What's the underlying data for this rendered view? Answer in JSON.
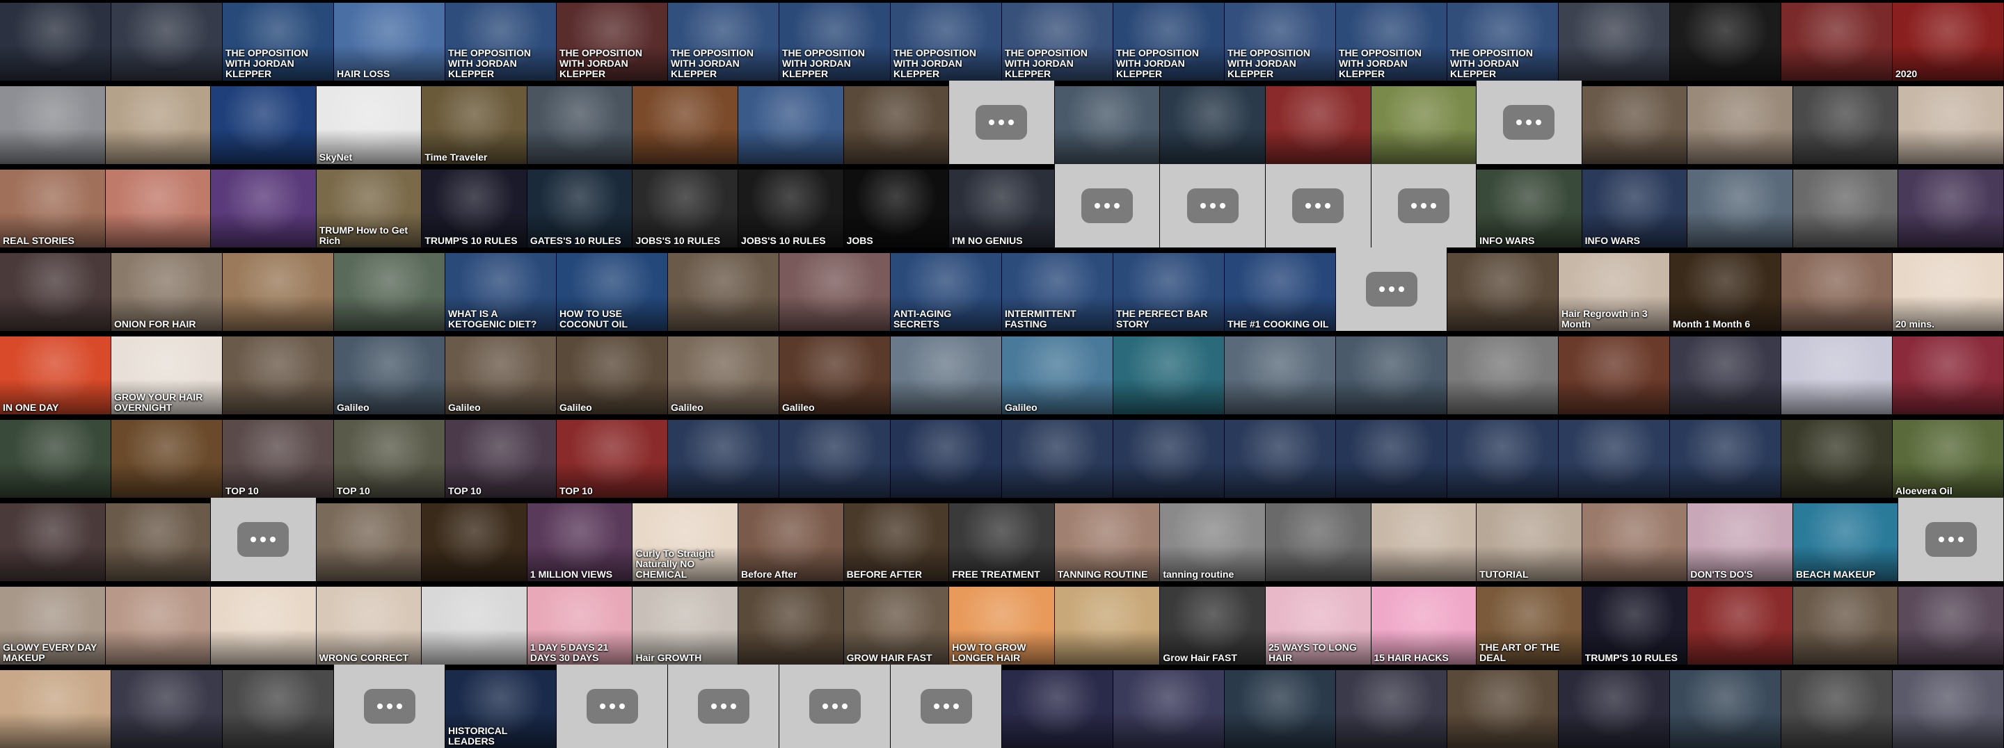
{
  "colors": {
    "background": "#000000",
    "placeholder": "#c9c9c9",
    "more_button": "#7b7b7b"
  },
  "more_icon": "ellipsis-icon",
  "rows": [
    {
      "tiles": [
        {
          "caption": "",
          "color": "#2b3140"
        },
        {
          "caption": "",
          "color": "#353b4a"
        },
        {
          "caption": "THE OPPOSITION WITH JORDAN KLEPPER",
          "color": "#274a7a"
        },
        {
          "caption": "HAIR LOSS",
          "color": "#4a6fa5"
        },
        {
          "caption": "THE OPPOSITION WITH JORDAN KLEPPER",
          "color": "#2e4d7c"
        },
        {
          "caption": "THE OPPOSITION WITH JORDAN KLEPPER",
          "color": "#5a2d2d"
        },
        {
          "caption": "THE OPPOSITION WITH JORDAN KLEPPER",
          "color": "#32507e"
        },
        {
          "caption": "THE OPPOSITION WITH JORDAN KLEPPER",
          "color": "#2c4a78"
        },
        {
          "caption": "THE OPPOSITION WITH JORDAN KLEPPER",
          "color": "#304d7a"
        },
        {
          "caption": "THE OPPOSITION WITH JORDAN KLEPPER",
          "color": "#38517a"
        },
        {
          "caption": "THE OPPOSITION WITH JORDAN KLEPPER",
          "color": "#2a4876"
        },
        {
          "caption": "THE OPPOSITION WITH JORDAN KLEPPER",
          "color": "#334f7d"
        },
        {
          "caption": "THE OPPOSITION WITH JORDAN KLEPPER",
          "color": "#2d4b79"
        },
        {
          "caption": "THE OPPOSITION WITH JORDAN KLEPPER",
          "color": "#314e7b"
        },
        {
          "caption": "",
          "color": "#3c4250"
        },
        {
          "caption": "",
          "color": "#1b1b1b"
        },
        {
          "caption": "",
          "color": "#7a2a2a"
        },
        {
          "caption": "2020",
          "color": "#8a1f1f"
        }
      ]
    },
    {
      "tiles": [
        {
          "caption": "",
          "color": "#8d8f94"
        },
        {
          "caption": "",
          "color": "#b5a28a"
        },
        {
          "caption": "",
          "color": "#1e3f7a"
        },
        {
          "caption": "SkyNet",
          "color": "#e8e8e8"
        },
        {
          "caption": "Time Traveler",
          "color": "#6a5a3a"
        },
        {
          "caption": "",
          "color": "#4a5560"
        },
        {
          "caption": "",
          "color": "#7a4a2a"
        },
        {
          "caption": "",
          "color": "#3a5a8a"
        },
        {
          "caption": "",
          "color": "#5a4a3a"
        },
        {
          "caption": "",
          "color": "placeholder"
        },
        {
          "caption": "",
          "color": "#4a5a6a"
        },
        {
          "caption": "",
          "color": "#2a3a4a"
        },
        {
          "caption": "",
          "color": "#8a2a2a"
        },
        {
          "caption": "",
          "color": "#7a8a4a"
        },
        {
          "caption": "",
          "color": "placeholder"
        },
        {
          "caption": "",
          "color": "#6a5a4a"
        },
        {
          "caption": "",
          "color": "#9a8a7a"
        },
        {
          "caption": "",
          "color": "#4a4a4a"
        },
        {
          "caption": "",
          "color": "#c8b8a8"
        }
      ]
    },
    {
      "tiles": [
        {
          "caption": "REAL STORIES",
          "color": "#a0705a"
        },
        {
          "caption": "",
          "color": "#c07a6a"
        },
        {
          "caption": "",
          "color": "#5a3a7a"
        },
        {
          "caption": "TRUMP How to Get Rich",
          "color": "#7a6a4a"
        },
        {
          "caption": "TRUMP'S 10 RULES",
          "color": "#1a1a2a"
        },
        {
          "caption": "GATES'S 10 RULES",
          "color": "#1a2a3a"
        },
        {
          "caption": "JOBS'S 10 RULES",
          "color": "#2a2a2a"
        },
        {
          "caption": "JOBS'S 10 RULES",
          "color": "#1a1a1a"
        },
        {
          "caption": "JOBS",
          "color": "#0e0e0e"
        },
        {
          "caption": "I'M NO GENIUS",
          "color": "#2a2f3a"
        },
        {
          "caption": "",
          "color": "placeholder"
        },
        {
          "caption": "",
          "color": "placeholder"
        },
        {
          "caption": "",
          "color": "placeholder"
        },
        {
          "caption": "",
          "color": "placeholder"
        },
        {
          "caption": "INFO WARS",
          "color": "#3a4a3a"
        },
        {
          "caption": "INFO WARS",
          "color": "#2a3a5a"
        },
        {
          "caption": "",
          "color": "#5a6a7a"
        },
        {
          "caption": "",
          "color": "#6a6a6a"
        },
        {
          "caption": "",
          "color": "#4a3a5a"
        }
      ]
    },
    {
      "tiles": [
        {
          "caption": "",
          "color": "#4a3a3a"
        },
        {
          "caption": "ONION FOR HAIR",
          "color": "#8a7a6a"
        },
        {
          "caption": "",
          "color": "#9a7a5a"
        },
        {
          "caption": "",
          "color": "#5a6a5a"
        },
        {
          "caption": "WHAT IS A KETOGENIC DIET?",
          "color": "#2a4a7a"
        },
        {
          "caption": "HOW TO USE COCONUT OIL",
          "color": "#24487a"
        },
        {
          "caption": "",
          "color": "#6a5a4a"
        },
        {
          "caption": "",
          "color": "#7a5a5a"
        },
        {
          "caption": "ANTI-AGING SECRETS",
          "color": "#2a4a7a"
        },
        {
          "caption": "INTERMITTENT FASTING",
          "color": "#2c4c7c"
        },
        {
          "caption": "THE PERFECT BAR STORY",
          "color": "#2a4a7a"
        },
        {
          "caption": "THE #1 COOKING OIL",
          "color": "#27477a"
        },
        {
          "caption": "",
          "color": "placeholder"
        },
        {
          "caption": "",
          "color": "#5a4a3a"
        },
        {
          "caption": "Hair Regrowth in 3 Month",
          "color": "#c8b8a8"
        },
        {
          "caption": "Month 1 Month 6",
          "color": "#3a2a1a"
        },
        {
          "caption": "",
          "color": "#8a6a5a"
        },
        {
          "caption": "20 mins.",
          "color": "#e8d8c8"
        }
      ]
    },
    {
      "tiles": [
        {
          "caption": "IN ONE DAY",
          "color": "#d84a2a"
        },
        {
          "caption": "GROW YOUR HAIR OVERNIGHT",
          "color": "#e8e0d8"
        },
        {
          "caption": "",
          "color": "#6a5a4a"
        },
        {
          "caption": "Galileo",
          "color": "#4a5a6a"
        },
        {
          "caption": "Galileo",
          "color": "#6a5a4a"
        },
        {
          "caption": "Galileo",
          "color": "#5a4a3a"
        },
        {
          "caption": "Galileo",
          "color": "#7a6a5a"
        },
        {
          "caption": "Galileo",
          "color": "#5a3a2a"
        },
        {
          "caption": "",
          "color": "#6a7a8a"
        },
        {
          "caption": "Galileo",
          "color": "#4a7a9a"
        },
        {
          "caption": "",
          "color": "#2a6a7a"
        },
        {
          "caption": "",
          "color": "#5a6a7a"
        },
        {
          "caption": "",
          "color": "#4a5a6a"
        },
        {
          "caption": "",
          "color": "#7a7a7a"
        },
        {
          "caption": "",
          "color": "#6a3a2a"
        },
        {
          "caption": "",
          "color": "#3a3a4a"
        },
        {
          "caption": "",
          "color": "#c8c8d8"
        },
        {
          "caption": "",
          "color": "#8a2a3a"
        }
      ]
    },
    {
      "tiles": [
        {
          "caption": "",
          "color": "#3a4a3a"
        },
        {
          "caption": "",
          "color": "#6a4a2a"
        },
        {
          "caption": "TOP 10",
          "color": "#5a4a4a"
        },
        {
          "caption": "TOP 10",
          "color": "#5a5a4a"
        },
        {
          "caption": "TOP 10",
          "color": "#4a3a4a"
        },
        {
          "caption": "TOP 10",
          "color": "#8a2a2a"
        },
        {
          "caption": "",
          "color": "#2a3a5a"
        },
        {
          "caption": "",
          "color": "#2a3a5a"
        },
        {
          "caption": "",
          "color": "#243456"
        },
        {
          "caption": "",
          "color": "#2a3a5a"
        },
        {
          "caption": "",
          "color": "#283858"
        },
        {
          "caption": "",
          "color": "#2a3a5a"
        },
        {
          "caption": "",
          "color": "#263656"
        },
        {
          "caption": "",
          "color": "#2a3a5a"
        },
        {
          "caption": "",
          "color": "#2c3c5c"
        },
        {
          "caption": "",
          "color": "#2a3a5a"
        },
        {
          "caption": "",
          "color": "#3a3a2a"
        },
        {
          "caption": "Aloevera Oil",
          "color": "#5a6a3a"
        }
      ]
    },
    {
      "tiles": [
        {
          "caption": "",
          "color": "#4a3a3a"
        },
        {
          "caption": "",
          "color": "#6a5a4a"
        },
        {
          "caption": "",
          "color": "placeholder"
        },
        {
          "caption": "",
          "color": "#7a6a5a"
        },
        {
          "caption": "",
          "color": "#3a2a1a"
        },
        {
          "caption": "1 MILLION VIEWS",
          "color": "#5a3a5a"
        },
        {
          "caption": "Curly To Straight Naturally NO CHEMICAL",
          "color": "#e8d8c8"
        },
        {
          "caption": "Before After",
          "color": "#7a5a4a"
        },
        {
          "caption": "BEFORE AFTER",
          "color": "#4a3a2a"
        },
        {
          "caption": "FREE TREATMENT",
          "color": "#3a3a3a"
        },
        {
          "caption": "TANNING ROUTINE",
          "color": "#a08070"
        },
        {
          "caption": "tanning routine",
          "color": "#8a8a8a"
        },
        {
          "caption": "",
          "color": "#6a6a6a"
        },
        {
          "caption": "",
          "color": "#c8b8a8"
        },
        {
          "caption": "TUTORIAL",
          "color": "#b8a898"
        },
        {
          "caption": "",
          "color": "#9a7a6a"
        },
        {
          "caption": "DON'TS DO'S",
          "color": "#c8a8b8"
        },
        {
          "caption": "BEACH MAKEUP",
          "color": "#2a7a9a"
        },
        {
          "caption": "",
          "color": "placeholder"
        }
      ]
    },
    {
      "tiles": [
        {
          "caption": "GLOWY EVERY DAY MAKEUP",
          "color": "#a8988a"
        },
        {
          "caption": "",
          "color": "#b89888"
        },
        {
          "caption": "",
          "color": "#e8d8c8"
        },
        {
          "caption": "WRONG CORRECT",
          "color": "#d8c8b8"
        },
        {
          "caption": "",
          "color": "#d8d8d8"
        },
        {
          "caption": "1 DAY 5 DAYS 21 DAYS 30 DAYS",
          "color": "#e8a8b8"
        },
        {
          "caption": "Hair GROWTH",
          "color": "#c8c0b8"
        },
        {
          "caption": "",
          "color": "#5a4a3a"
        },
        {
          "caption": "GROW HAIR FAST",
          "color": "#6a5a4a"
        },
        {
          "caption": "HOW TO GROW LONGER HAIR",
          "color": "#e89a5a"
        },
        {
          "caption": "",
          "color": "#c8a878"
        },
        {
          "caption": "Grow Hair FAST",
          "color": "#3a3a3a"
        },
        {
          "caption": "25 WAYS TO LONG HAIR",
          "color": "#e8b8c8"
        },
        {
          "caption": "15 HAIR HACKS",
          "color": "#f0a8c8"
        },
        {
          "caption": "THE ART OF THE DEAL",
          "color": "#7a5a3a"
        },
        {
          "caption": "TRUMP'S 10 RULES",
          "color": "#1a1a2a"
        },
        {
          "caption": "",
          "color": "#8a2a2a"
        },
        {
          "caption": "",
          "color": "#6a5a4a"
        },
        {
          "caption": "",
          "color": "#5a4a5a"
        }
      ]
    },
    {
      "tiles": [
        {
          "caption": "",
          "color": "#c8a888"
        },
        {
          "caption": "",
          "color": "#3a3a4a"
        },
        {
          "caption": "",
          "color": "#4a4a4a"
        },
        {
          "caption": "",
          "color": "placeholder"
        },
        {
          "caption": "HISTORICAL LEADERS",
          "color": "#1a2a4a"
        },
        {
          "caption": "",
          "color": "placeholder"
        },
        {
          "caption": "",
          "color": "placeholder"
        },
        {
          "caption": "",
          "color": "placeholder"
        },
        {
          "caption": "",
          "color": "placeholder"
        },
        {
          "caption": "",
          "color": "#2a2a4a"
        },
        {
          "caption": "",
          "color": "#3a3a5a"
        },
        {
          "caption": "",
          "color": "#2a3a4a"
        },
        {
          "caption": "",
          "color": "#3a3a4a"
        },
        {
          "caption": "",
          "color": "#5a4a3a"
        },
        {
          "caption": "",
          "color": "#2a2a3a"
        },
        {
          "caption": "",
          "color": "#3a4a5a"
        },
        {
          "caption": "",
          "color": "#4a4a4a"
        },
        {
          "caption": "",
          "color": "#5a5a6a"
        }
      ]
    }
  ]
}
